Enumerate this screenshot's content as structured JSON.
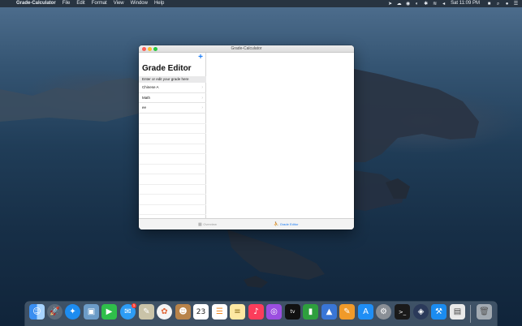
{
  "menubar": {
    "app_name": "Grade-Calculator",
    "menus": [
      "File",
      "Edit",
      "Format",
      "View",
      "Window",
      "Help"
    ],
    "clock": "Sat 11:09 PM"
  },
  "window": {
    "title": "Grade-Calculator"
  },
  "master": {
    "title": "Grade Editor",
    "section_header": "Enter or edit your grade here",
    "rows": [
      {
        "label": "Chinese A"
      },
      {
        "label": "Math"
      },
      {
        "label": "ee"
      }
    ]
  },
  "tabbar": {
    "tabs": [
      {
        "label": "Overview",
        "icon": "table-icon",
        "active": false
      },
      {
        "label": "Grade Editor",
        "icon": "person-icon",
        "active": true
      }
    ]
  },
  "dock": {
    "messages_badge": "1",
    "calendar_day": "23",
    "items": [
      "finder",
      "launchpad",
      "safari",
      "preview",
      "facetime",
      "messages",
      "script-editor",
      "photos",
      "contacts",
      "calendar",
      "reminders",
      "notes",
      "music",
      "podcasts",
      "apple-tv",
      "numbers",
      "keynote",
      "pages",
      "app-store",
      "system-preferences",
      "terminal",
      "xcode-instruments",
      "xcode",
      "archive-utility",
      "trash"
    ]
  },
  "colors": {
    "accent": "#1b7cf5",
    "close": "#fe5f57",
    "minimize": "#febc2e",
    "maximize": "#28c840"
  }
}
